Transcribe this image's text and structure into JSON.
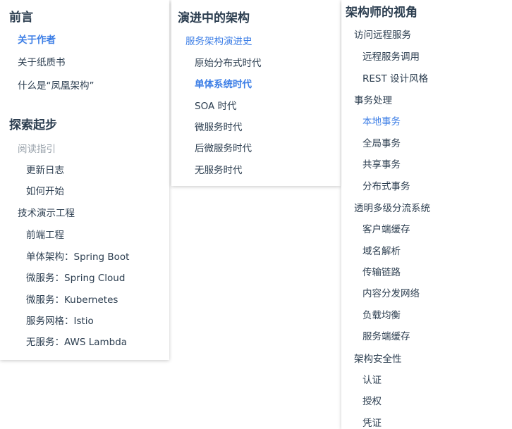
{
  "columns": [
    {
      "sections": [
        {
          "title": "前言",
          "items": [
            {
              "label": "关于作者",
              "state": "active-bold"
            },
            {
              "label": "关于纸质书"
            },
            {
              "label": "什么是“凤凰架构”"
            }
          ]
        },
        {
          "title": "探索起步",
          "items": [
            {
              "label": "阅读指引",
              "state": "muted"
            },
            {
              "label": "更新日志"
            },
            {
              "label": "如何开始"
            },
            {
              "label": "技术演示工程"
            },
            {
              "label": "前端工程"
            },
            {
              "label": "单体架构：Spring Boot"
            },
            {
              "label": "微服务：Spring Cloud"
            },
            {
              "label": "微服务：Kubernetes"
            },
            {
              "label": "服务网格：Istio"
            },
            {
              "label": "无服务：AWS Lambda"
            }
          ]
        }
      ]
    },
    {
      "sections": [
        {
          "title": "演进中的架构",
          "items": [
            {
              "label": "服务架构演进史",
              "state": "active"
            },
            {
              "label": "原始分布式时代"
            },
            {
              "label": "单体系统时代",
              "state": "active-bold"
            },
            {
              "label": "SOA 时代"
            },
            {
              "label": "微服务时代"
            },
            {
              "label": "后微服务时代"
            },
            {
              "label": "无服务时代"
            }
          ]
        }
      ]
    },
    {
      "sections": [
        {
          "title": "架构师的视角",
          "items": [
            {
              "label": "访问远程服务"
            },
            {
              "label": "远程服务调用"
            },
            {
              "label": "REST 设计风格"
            },
            {
              "label": "事务处理"
            },
            {
              "label": "本地事务",
              "state": "active"
            },
            {
              "label": "全局事务"
            },
            {
              "label": "共享事务"
            },
            {
              "label": "分布式事务"
            },
            {
              "label": "透明多级分流系统"
            },
            {
              "label": "客户端缓存"
            },
            {
              "label": "域名解析"
            },
            {
              "label": "传输链路"
            },
            {
              "label": "内容分发网络"
            },
            {
              "label": "负载均衡"
            },
            {
              "label": "服务端缓存"
            },
            {
              "label": "架构安全性"
            },
            {
              "label": "认证"
            },
            {
              "label": "授权"
            },
            {
              "label": "凭证"
            }
          ]
        }
      ]
    }
  ],
  "colors": {
    "text": "#2c3e50",
    "active": "#3c7ee6",
    "muted": "#9aa3ac"
  }
}
